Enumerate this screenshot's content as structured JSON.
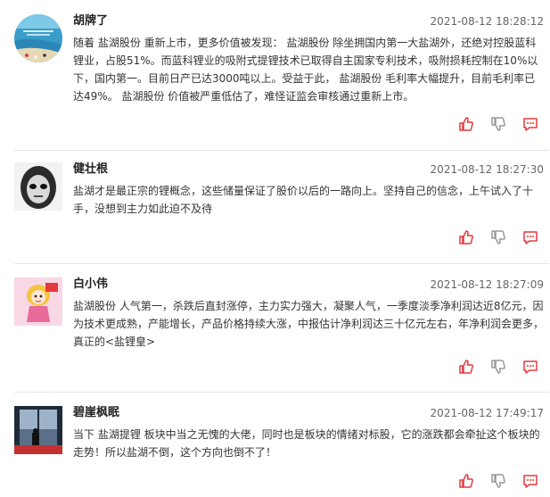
{
  "posts": [
    {
      "name": "胡牌了",
      "time": "2021-08-12 18:28:12",
      "content": "随着 盐湖股份 重新上市，更多价值被发现： 盐湖股份 除坐拥国内第一大盐湖外，还绝对控股蓝科锂业，占股51%。而蓝科锂业的吸附式提锂技术已取得自主国家专利技术，吸附损耗控制在10%以下，国内第一。目前日产已达3000吨以上。受益于此， 盐湖股份 毛利率大幅提升，目前毛利率已达49%。 盐湖股份 价值被严重低估了，难怪证监会审核通过重新上市。",
      "avatar": "beach-photo"
    },
    {
      "name": "健壮根",
      "time": "2021-08-12 18:27:30",
      "content": "盐湖才是最正宗的锂概念，这些储量保证了股价以后的一路向上。坚持自己的信念，上午试入了十手，没想到主力如此迫不及待",
      "avatar": "monochrome-face"
    },
    {
      "name": "白小伟",
      "time": "2021-08-12 18:27:09",
      "content": "盐湖股份 人气第一，杀跌后直封涨停，主力实力强大，凝聚人气，一季度淡季净利润达近8亿元，因为技术更成熟，产能增长，产品价格持续大涨，中报估计净利润达三十亿元左右，年净利润会更多，真正的<盐锂皇>",
      "avatar": "cartoon-girl"
    },
    {
      "name": "碧崖枫眠",
      "time": "2021-08-12 17:49:17",
      "content": "当下 盐湖提锂 板块中当之无愧的大佬，同时也是板块的情绪对标股，它的涨跌都会牵扯这个板块的走势！所以盐湖不倒，这个方向也倒不了！",
      "avatar": "window-silhouette"
    }
  ],
  "colors": {
    "accent": "#e4393c",
    "icon_gray": "#999999"
  },
  "icons": [
    "thumbs-up-icon",
    "thumbs-down-icon",
    "comment-icon"
  ]
}
